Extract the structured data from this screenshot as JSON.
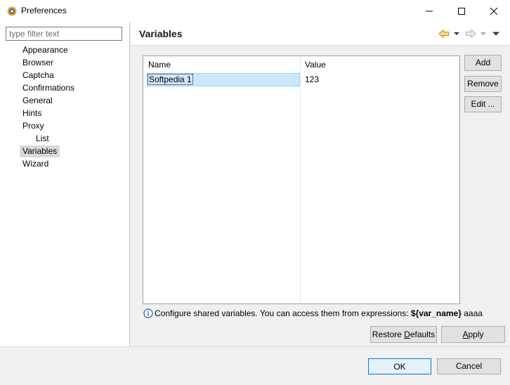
{
  "window": {
    "title": "Preferences",
    "controls": {
      "minimize": "minimize",
      "maximize": "maximize",
      "close": "close"
    }
  },
  "filter": {
    "placeholder": "type filter text",
    "value": ""
  },
  "tree": {
    "items": [
      {
        "label": "Appearance",
        "level": 0,
        "selected": false
      },
      {
        "label": "Browser",
        "level": 0,
        "selected": false
      },
      {
        "label": "Captcha",
        "level": 0,
        "selected": false
      },
      {
        "label": "Confirmations",
        "level": 0,
        "selected": false
      },
      {
        "label": "General",
        "level": 0,
        "selected": false
      },
      {
        "label": "Hints",
        "level": 0,
        "selected": false
      },
      {
        "label": "Proxy",
        "level": 0,
        "selected": false
      },
      {
        "label": "List",
        "level": 1,
        "selected": false
      },
      {
        "label": "Variables",
        "level": 0,
        "selected": true
      },
      {
        "label": "Wizard",
        "level": 0,
        "selected": false
      }
    ]
  },
  "page": {
    "title": "Variables",
    "nav_icons": [
      "back-arrow-icon",
      "dropdown-arrow-icon",
      "forward-arrow-icon",
      "dropdown-arrow-icon",
      "view-menu-icon"
    ],
    "accent_color": "#e8a317"
  },
  "table": {
    "columns": [
      "Name",
      "Value"
    ],
    "rows": [
      {
        "name": "Softpedia 1",
        "value": "123",
        "selected": true
      }
    ]
  },
  "side_buttons": {
    "add": "Add",
    "remove": "Remove",
    "edit": "Edit ..."
  },
  "info": {
    "icon": "info-icon",
    "text_before": "Configure shared variables. You can access them from expressions: ",
    "var_token": "${var_name}",
    "text_after": " aaaa"
  },
  "page_buttons": {
    "restore_defaults_pre": "Restore ",
    "restore_defaults_mnemonic": "D",
    "restore_defaults_post": "efaults",
    "apply_mnemonic": "A",
    "apply_post": "pply"
  },
  "dialog_buttons": {
    "ok": "OK",
    "cancel": "Cancel"
  }
}
